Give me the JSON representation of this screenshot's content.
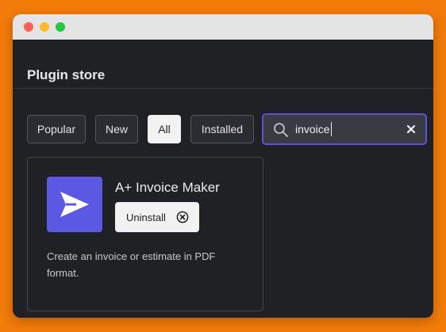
{
  "window": {
    "controls": [
      "close",
      "minimize",
      "zoom"
    ],
    "title": "Plugin store"
  },
  "filters": {
    "items": [
      {
        "label": "Popular",
        "active": false
      },
      {
        "label": "New",
        "active": false
      },
      {
        "label": "All",
        "active": true
      },
      {
        "label": "Installed",
        "active": false
      }
    ]
  },
  "search": {
    "value": "invoice",
    "icon": "search-icon",
    "clear_icon": "close-icon"
  },
  "plugins": [
    {
      "name": "A+ Invoice Maker",
      "icon": "send-arrow-icon",
      "action_label": "Uninstall",
      "action_icon": "circle-x-icon",
      "description": "Create an invoice or estimate in PDF format."
    }
  ],
  "colors": {
    "accent": "#5b58e3",
    "background": "#202124",
    "page_background": "#f27b0a"
  }
}
